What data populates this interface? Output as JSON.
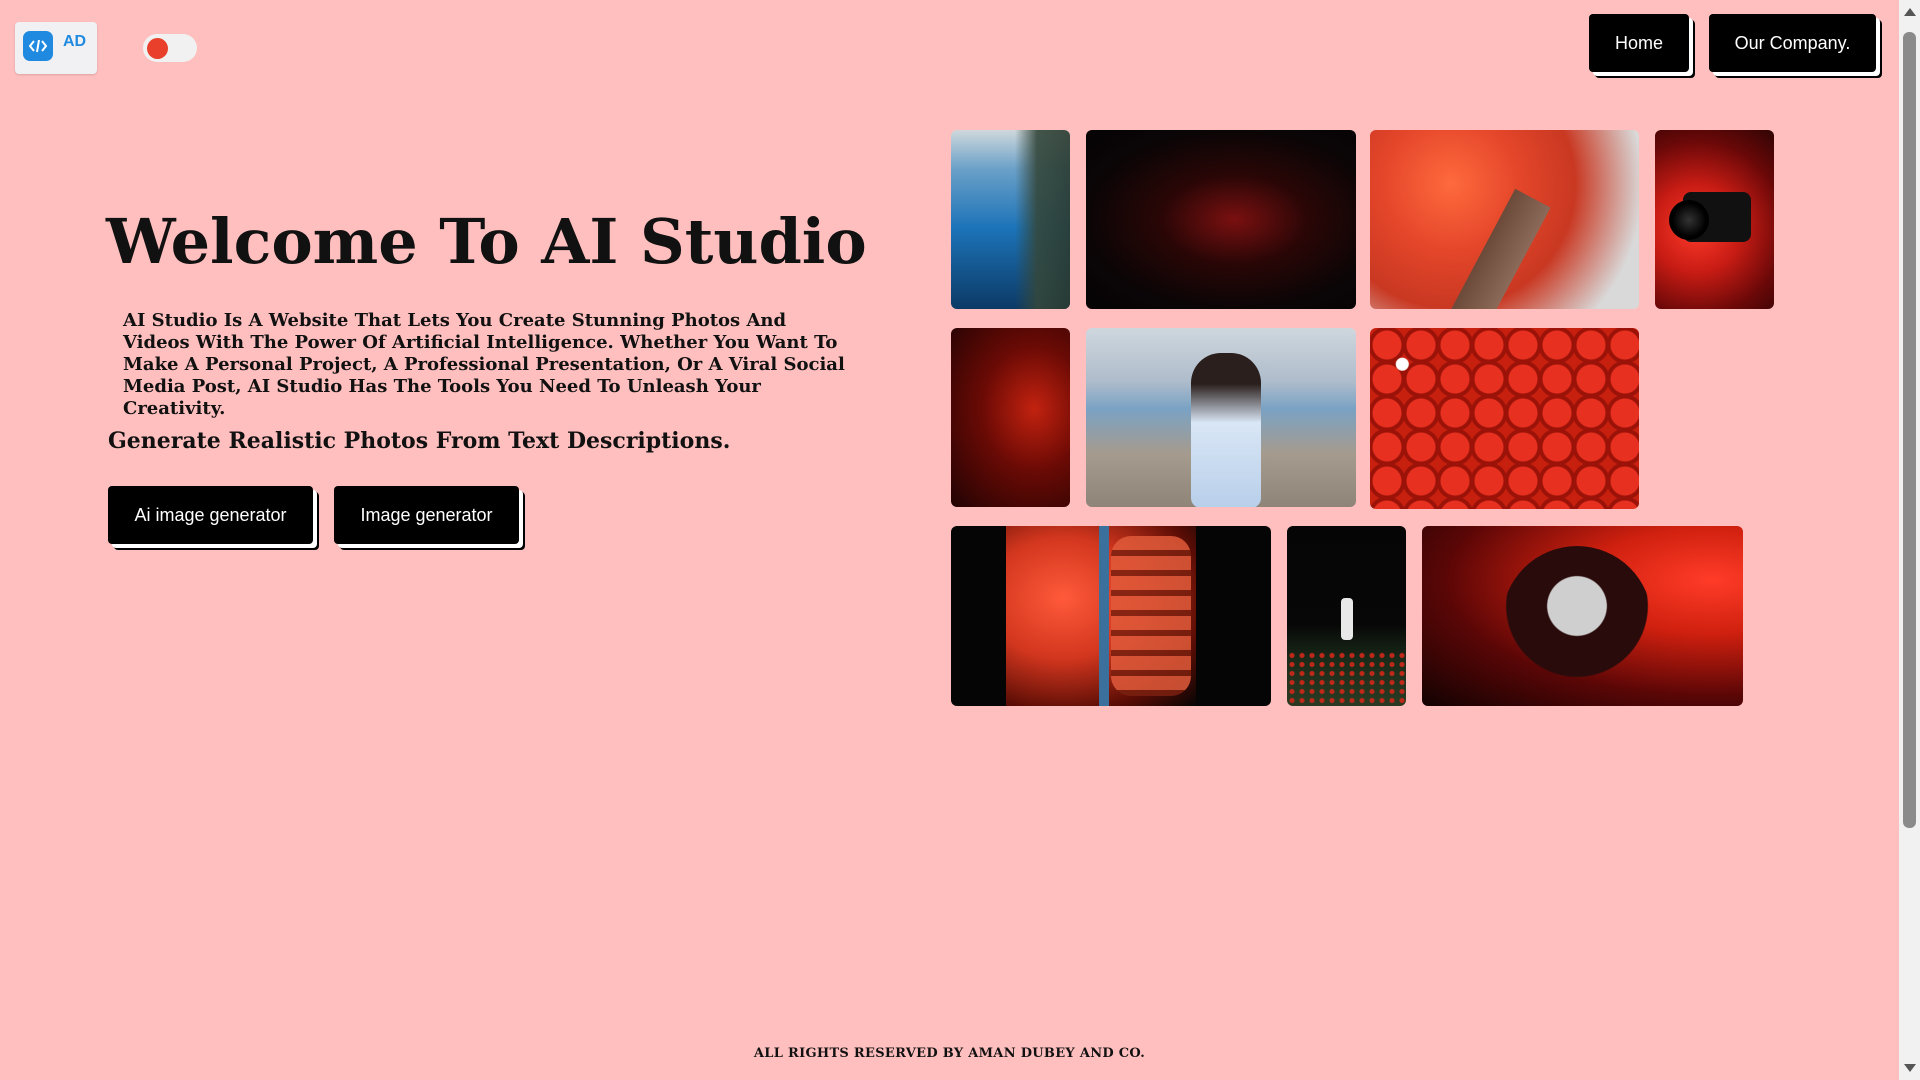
{
  "logo": {
    "text": "AD",
    "icon": "code-icon",
    "brand_color": "#1f8ae0"
  },
  "theme_toggle": {
    "icon": "toggle-switch",
    "knob_color": "#e8402a"
  },
  "nav": {
    "home_label": "Home",
    "company_label": "Our Company."
  },
  "hero": {
    "title": "Welcome To AI Studio",
    "description": "AI Studio Is A Website That Lets You Create Stunning Photos And Videos With The Power Of Artificial Intelligence. Whether You Want To Make A Personal Project, A Professional Presentation, Or A Viral Social Media Post, AI Studio Has The Tools You Need To Unleash Your Creativity.",
    "subtitle": "Generate Realistic Photos From Text Descriptions."
  },
  "actions": {
    "ai_image_label": "Ai image generator",
    "image_label": "Image generator"
  },
  "gallery": {
    "images": [
      "underwater-diver",
      "red-light-car-night",
      "red-maple-tree",
      "camera-red-light",
      "red-silhouette",
      "woman-on-beach",
      "daruma-dolls",
      "red-fruit-closeup",
      "man-in-flower-field",
      "abstract-red-shape"
    ]
  },
  "footer": {
    "text": "ALL RIGHTS RESERVED BY AMAN DUBEY AND CO."
  },
  "colors": {
    "background": "#ffbfbf",
    "button": "#000000",
    "button_text": "#ffffff"
  }
}
